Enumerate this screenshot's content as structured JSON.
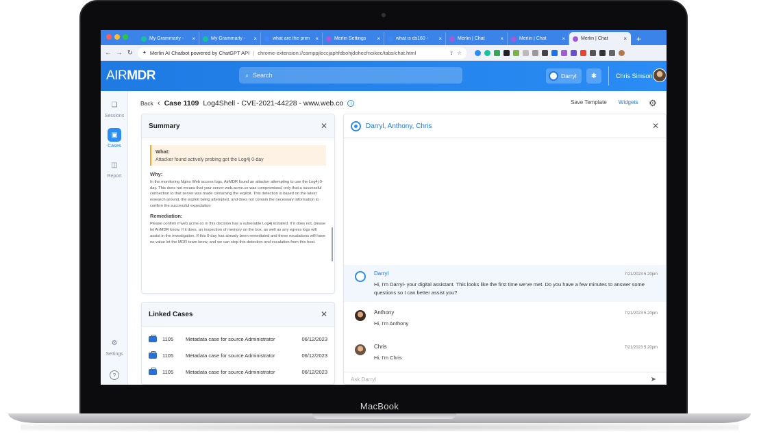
{
  "device": {
    "label": "MacBook"
  },
  "browser": {
    "tabs": [
      {
        "label": "My Grammarly - ",
        "color": "#15c39a"
      },
      {
        "label": "My Grammarly - ",
        "color": "#15c39a"
      },
      {
        "label": "what are the prim",
        "color": "#4285f4"
      },
      {
        "label": "Merlin Settings",
        "color": "#a35cd6"
      },
      {
        "label": "what is ds160 - ",
        "color": "#4285f4"
      },
      {
        "label": "Merlin | Chat",
        "color": "#a35cd6"
      },
      {
        "label": "Merlin | Chat",
        "color": "#a35cd6"
      },
      {
        "label": "Merlin | Chat",
        "color": "#a35cd6",
        "active": true
      }
    ],
    "new_tab": "+",
    "close_glyph": "×",
    "omnibox": {
      "title": "Merlin AI Chatbot powered by ChatGPT API",
      "separator": "|",
      "url": "chrome-extension://camppjleccjaphfdbohjdohecfnoikec/tabs/chat.html"
    }
  },
  "app": {
    "brand_a": "AIR",
    "brand_b": "MDR",
    "search_placeholder": "Search",
    "assistant_chip": "Darryl",
    "user_name": "Chris Simson"
  },
  "nav": {
    "items": [
      {
        "label": "Sessions",
        "icon": "chat-bubbles-icon"
      },
      {
        "label": "Cases",
        "icon": "briefcase-icon",
        "active": true
      },
      {
        "label": "Report",
        "icon": "chart-icon"
      },
      {
        "label": "Settings",
        "icon": "gear-icon"
      }
    ],
    "help": "?"
  },
  "breadcrumb": {
    "back": "Back",
    "case_number": "Case 1109",
    "case_title": "Log4Shell - CVE-2021-44228 - www.web.co"
  },
  "toolbar": {
    "save_template": "Save Template",
    "widgets": "Widgets"
  },
  "summary": {
    "title": "Summary",
    "what_title": "What:",
    "what_text": "Attacker found actively probing got the Log4j 0-day",
    "why_title": "Why:",
    "why_text": "In the monitoring Nginx Web access logs, AirMDR found an attacker attempting to use the Log4j 0-day. This does not means that your server web.acme.co was compromised, only that a successful connection to that server was made containing the exploit. This detection is based on the latest research around, the exploit being attempted, and does not contain the necessary information to confirm the successful expectation",
    "remediation_title": "Remediation:",
    "remediation_text": "Please confirm if web.acme.co in this decision has a vulnerable Log4j installed. If it does not, please let AirMDR know. If it does, an inspection of memory on the box, as well as any egress logs will assist in the investigation. If this 0-day has already been remediated and these escalations will have no value let the MDR team know, and we can stop this detection and escalation from this host."
  },
  "linked_cases": {
    "title": "Linked Cases",
    "rows": [
      {
        "id": "1105",
        "desc": "Metadata case for source Administrator",
        "date": "06/12/2023"
      },
      {
        "id": "1105",
        "desc": "Metadata case for source Administrator",
        "date": "06/12/2023"
      },
      {
        "id": "1105",
        "desc": "Metadata case for source Administrator",
        "date": "06/12/2023"
      }
    ]
  },
  "chat": {
    "title": "Darryl, Anthony, Chris",
    "messages": [
      {
        "name": "Darryl",
        "time": "7/21/2023 5.20pm",
        "text": "Hi, I'm Darryl- your digital assistant.  This looks like the first time we've met.  Do you have a few minutes to answer some questions so I can better assist you?"
      },
      {
        "name": "Anthony",
        "time": "7/21/2023 5.20pm",
        "text": "Hi, I'm Anthony"
      },
      {
        "name": "Chris",
        "time": "7/21/2023 5.20pm",
        "text": "Hi, I'm Chris"
      }
    ],
    "input_placeholder": "Ask Darryl"
  }
}
